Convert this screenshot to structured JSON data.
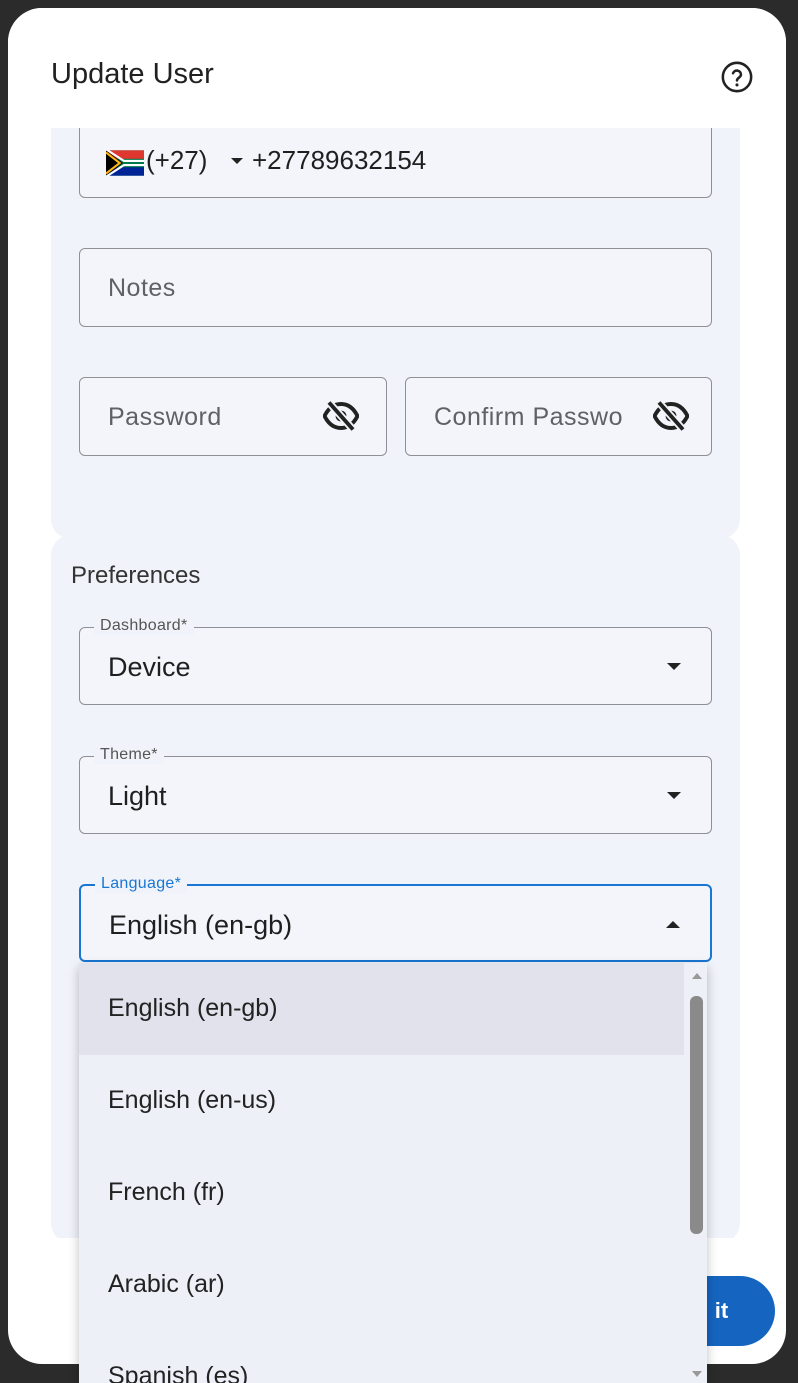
{
  "dialog": {
    "title": "Update User",
    "help_icon": "help-circle-icon",
    "submit_label": "it"
  },
  "phone": {
    "country_flag": "south-africa-flag",
    "country_code": "(+27)",
    "number": "+27789632154"
  },
  "notes": {
    "placeholder": "Notes"
  },
  "password": {
    "placeholder": "Password",
    "icon": "eye-off-icon"
  },
  "confirm_password": {
    "placeholder": "Confirm Passwo",
    "icon": "eye-off-icon"
  },
  "preferences": {
    "title": "Preferences",
    "dashboard": {
      "label": "Dashboard*",
      "value": "Device"
    },
    "theme": {
      "label": "Theme*",
      "value": "Light"
    },
    "language": {
      "label": "Language*",
      "value": "English (en-gb)"
    }
  },
  "language_menu": {
    "options": [
      "English (en-gb)",
      "English (en-us)",
      "French (fr)",
      "Arabic (ar)",
      "Spanish (es)"
    ],
    "selected": "English (en-gb)"
  },
  "colors": {
    "primary": "#1565c0",
    "card_background": "#f1f3fa",
    "focused_border": "#1976d2"
  }
}
